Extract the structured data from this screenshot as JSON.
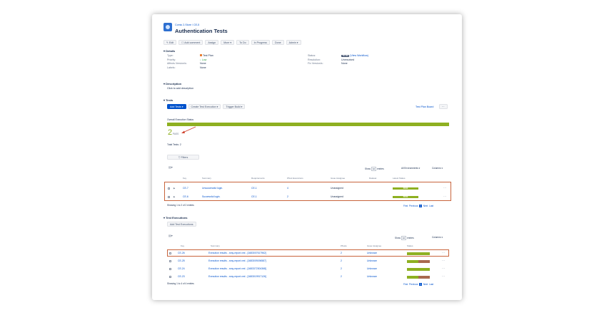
{
  "header": {
    "breadcrumb_project": "Comic 2-Store",
    "breadcrumb_sep": "/",
    "breadcrumb_issue": "CE-5",
    "title": "Authentication Tests"
  },
  "toolbar": {
    "edit": "✎ Edit",
    "comment": "☐ Add comment",
    "assign": "Assign",
    "more": "More ▾",
    "todo": "To Do",
    "in_progress": "In Progress",
    "done": "Done",
    "admin": "Admin ▾"
  },
  "details": {
    "heading": "Details",
    "type_label": "Type:",
    "type_value": "Test Plan",
    "priority_label": "Priority:",
    "priority_value": "↓ Low",
    "affects_label": "Affects Version/s:",
    "affects_value": "None",
    "labels_label": "Labels:",
    "labels_value": "None",
    "status_label": "Status:",
    "status_value": "TO DO",
    "status_workflow": "(View Workflow)",
    "resolution_label": "Resolution:",
    "resolution_value": "Unresolved",
    "fix_label": "Fix Version/s:",
    "fix_value": "None"
  },
  "description": {
    "heading": "Description",
    "placeholder": "Click to add description"
  },
  "tests": {
    "heading": "Tests",
    "add_tests": "Add Tests ▾",
    "create_exec": "Create Test Execution ▾",
    "trigger_build": "Trigger Build ▾",
    "board": "Test Plan Board",
    "more": "···",
    "overall_label": "Overall Execution Status",
    "pass_count": "2",
    "pass_label": "PASS",
    "total_label": "Total Tests: 2",
    "filters": "▽ Filters",
    "show_label": "Show",
    "show_value": "10",
    "entries_label": "entries",
    "environments": "All Environments ▾",
    "columns": "Columns ▾",
    "columns_headers": [
      "Key",
      "Summary",
      "Requirements",
      "#Test Executions",
      "Issue Assignee",
      "Dataset",
      "Latest Status"
    ],
    "rows": [
      {
        "key": "CE-7",
        "summary": "Unsuccessful login.",
        "requirements": "CE-1",
        "executions": "4",
        "assignee": "Unassigned",
        "status": "PASS"
      },
      {
        "key": "CE-6",
        "summary": "Successful login.",
        "requirements": "CE-1",
        "executions": "2",
        "assignee": "Unassigned",
        "status": "PASS"
      }
    ],
    "showing": "Showing 1 to 2 of 2 entries",
    "first": "First",
    "previous": "Previous",
    "page": "1",
    "next": "Next",
    "last": "Last"
  },
  "executions": {
    "heading": "Test Executions",
    "add": "Add Test Executions",
    "show_label": "Show",
    "show_value": "10",
    "entries_label": "entries",
    "columns": "Columns ▾",
    "columns_headers": [
      "Key",
      "Summary",
      "#Tests",
      "Issue Assignee",
      "Status"
    ],
    "rows": [
      {
        "key": "CE-26",
        "summary": "Execution results - xray-report.xml - [1683007617962]",
        "tests": "2",
        "assignee": "Unknown",
        "pass_frac": 1.0
      },
      {
        "key": "CE-25",
        "summary": "Execution results - xray-report.xml - [1683009196587]",
        "tests": "2",
        "assignee": "Unknown",
        "pass_frac": 0.5
      },
      {
        "key": "CE-24",
        "summary": "Execution results - xray-report.xml - [1683372304368]",
        "tests": "2",
        "assignee": "Unknown",
        "pass_frac": 1.0
      },
      {
        "key": "CE-23",
        "summary": "Execution results - xray-report.xml - [1683019917126]",
        "tests": "2",
        "assignee": "Unknown",
        "pass_frac": 0.5
      }
    ],
    "showing": "Showing 1 to 4 of 4 entries",
    "first": "First",
    "previous": "Previous",
    "page": "1",
    "next": "Next",
    "last": "Last"
  },
  "colors": {
    "pass": "#8eb021",
    "fail": "#a8694f",
    "accent": "#0052cc",
    "highlight": "#c8643c"
  }
}
